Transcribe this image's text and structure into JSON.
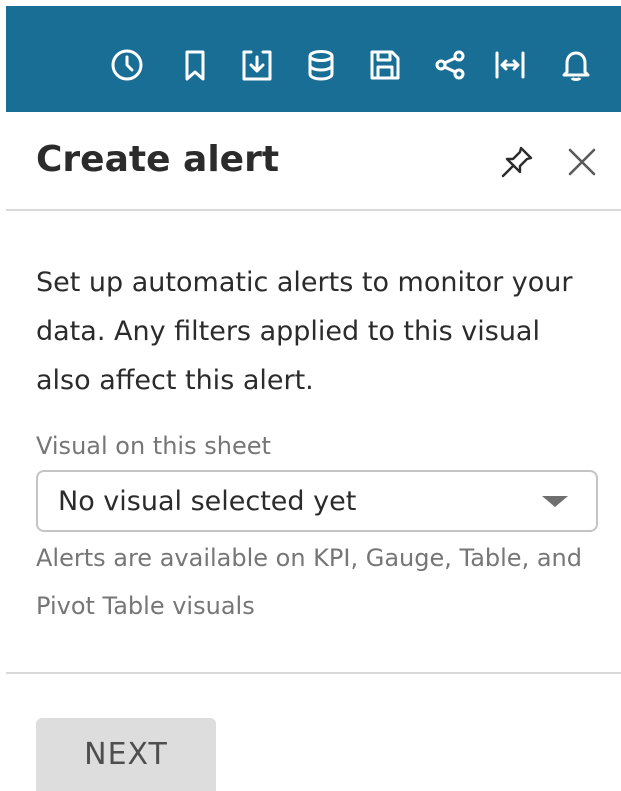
{
  "toolbar": {
    "background": "#196e95",
    "icons": [
      "clock-icon",
      "bookmark-icon",
      "download-icon",
      "database-icon",
      "save-icon",
      "share-icon",
      "fit-width-icon",
      "bell-icon"
    ]
  },
  "panel": {
    "title": "Create alert",
    "header_icons": [
      "pin-icon",
      "close-icon"
    ],
    "description": "Set up automatic alerts to monitor your data. Any filters applied to this visual also affect this alert.",
    "visual_field": {
      "label": "Visual on this sheet",
      "selected_value": "No visual selected yet",
      "hint": "Alerts are available on KPI, Gauge, Table, and Pivot Table visuals"
    },
    "next_button": "NEXT"
  }
}
